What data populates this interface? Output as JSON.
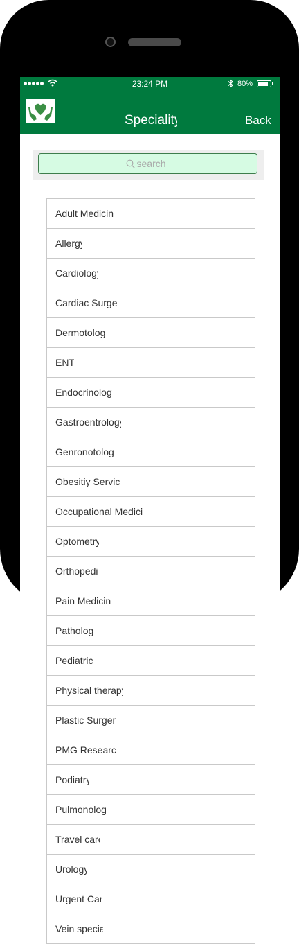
{
  "status_bar": {
    "time": "23:24 PM",
    "battery": "80%",
    "battery_level": 0.8
  },
  "nav": {
    "title": "Speciality",
    "back_label": "Back"
  },
  "search": {
    "placeholder": "search"
  },
  "specialities": [
    {
      "label": "Adult Medicin",
      "width": 85
    },
    {
      "label": "Allergy",
      "width": 39
    },
    {
      "label": "Cardiology",
      "width": 61
    },
    {
      "label": "Cardiac Surge",
      "width": 90
    },
    {
      "label": "Dermotolog",
      "width": 75
    },
    {
      "label": "ENT",
      "width": 27
    },
    {
      "label": "Endocrinology",
      "width": 82
    },
    {
      "label": "Gastroentrology",
      "width": 95
    },
    {
      "label": "Genronotology",
      "width": 85
    },
    {
      "label": "Obesitiy Servic",
      "width": 95
    },
    {
      "label": "Occupational Medici",
      "width": 130
    },
    {
      "label": "Optometry",
      "width": 63
    },
    {
      "label": "Orthopedi",
      "width": 63
    },
    {
      "label": "Pain Medicin",
      "width": 80
    },
    {
      "label": "Patholog",
      "width": 58
    },
    {
      "label": "Pediatric",
      "width": 57
    },
    {
      "label": "Physical therapy",
      "width": 97
    },
    {
      "label": "Plastic Surgery",
      "width": 88
    },
    {
      "label": "PMG Research",
      "width": 87
    },
    {
      "label": "Podiatry",
      "width": 48
    },
    {
      "label": "Pulmonology",
      "width": 75
    },
    {
      "label": "Travel care",
      "width": 65
    },
    {
      "label": "Urology",
      "width": 45
    },
    {
      "label": "Urgent Care",
      "width": 67
    },
    {
      "label": "Vein special",
      "width": 69
    }
  ],
  "icons": {
    "logo": "hands-heart-logo-icon",
    "search": "search-icon",
    "wifi": "wifi-icon",
    "bluetooth": "bluetooth-icon",
    "battery": "battery-icon"
  },
  "colors": {
    "brand": "#007a3e",
    "search_bg": "#d6fbe3"
  }
}
